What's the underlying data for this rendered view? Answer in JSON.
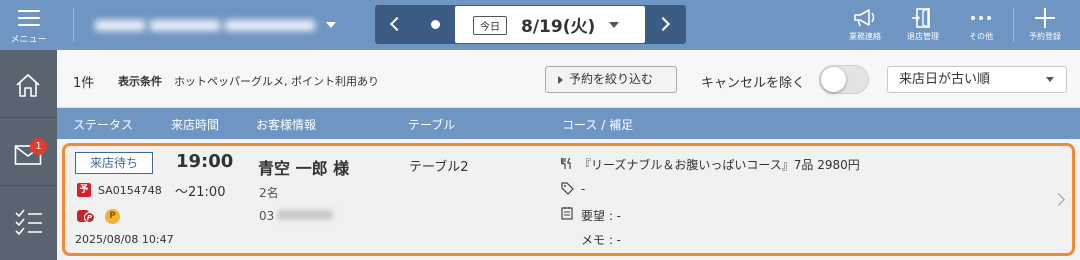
{
  "header": {
    "menu_label": "メニュー",
    "date_nav": {
      "today_label": "今日",
      "date": "8/19(火)"
    },
    "tools": [
      {
        "label": "業務連絡",
        "icon": "megaphone-icon"
      },
      {
        "label": "退店管理",
        "icon": "door-exit-icon"
      },
      {
        "label": "その他",
        "icon": "more-dots-icon"
      },
      {
        "label": "予約登録",
        "icon": "plus-icon"
      }
    ]
  },
  "sidebar": {
    "items": [
      {
        "icon": "home-icon"
      },
      {
        "icon": "mail-icon",
        "badge": "1"
      },
      {
        "icon": "checklist-icon"
      }
    ]
  },
  "filter": {
    "count": "1件",
    "condition_label": "表示条件",
    "condition_value": "ホットペッパーグルメ, ポイント利用あり",
    "narrow_button": "予約を絞り込む",
    "cancel_exclude_label": "キャンセルを除く",
    "cancel_exclude_on": false,
    "sort_selected": "来店日が古い順"
  },
  "table": {
    "columns": [
      "ステータス",
      "来店時間",
      "お客様情報",
      "テーブル",
      "コース / 補足"
    ],
    "rows": [
      {
        "status": "来店待ち",
        "time": "19:00",
        "time_end": "〜21:00",
        "reservation_icon": "予",
        "reservation_no": "SA0154748",
        "hp_icon": "P",
        "point_icon": "P",
        "created_at": "2025/08/08 10:47",
        "customer_name": "青空 一郎 様",
        "party_size": "2名",
        "phone_prefix": "03",
        "table_name": "テーブル2",
        "course": "『リーズナブル＆お腹いっぱいコース』7品 2980円",
        "tag": "-",
        "request": "要望 : -",
        "memo": "メモ : -"
      }
    ]
  },
  "colors": {
    "header_bg": "#6f96c3",
    "date_nav_bg": "#3c5b82",
    "sidebar_bg": "#5a6470",
    "highlight_border": "#f28a33",
    "badge_red": "#e23b30"
  }
}
